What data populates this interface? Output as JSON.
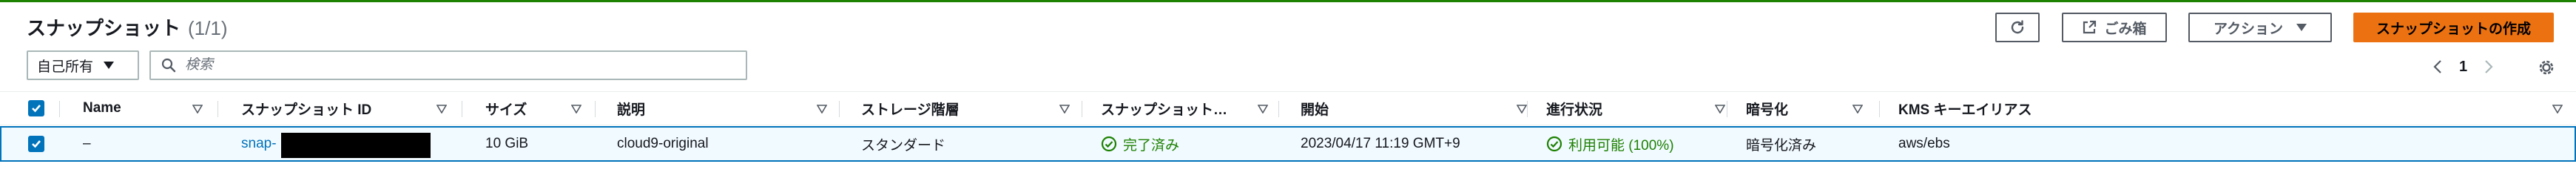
{
  "header": {
    "title": "スナップショット",
    "count": "(1/1)",
    "buttons": {
      "refresh_icon": "refresh-icon",
      "trash_label": "ごみ箱",
      "actions_label": "アクション",
      "create_label": "スナップショットの作成"
    }
  },
  "filters": {
    "owner_value": "自己所有",
    "search_placeholder": "検索"
  },
  "pagination": {
    "current_page": "1"
  },
  "table": {
    "columns": [
      "Name",
      "スナップショット ID",
      "サイズ",
      "説明",
      "ストレージ階層",
      "スナップショット…",
      "開始",
      "進行状況",
      "暗号化",
      "KMS キーエイリアス"
    ],
    "rows": [
      {
        "selected": true,
        "name": "–",
        "snapshot_id": "snap-",
        "size": "10 GiB",
        "description": "cloud9-original",
        "storage_tier": "スタンダード",
        "snapshot_status": "完了済み",
        "started": "2023/04/17 11:19 GMT+9",
        "progress": "利用可能 (100%)",
        "encryption": "暗号化済み",
        "kms_alias": "aws/ebs"
      }
    ]
  },
  "colors": {
    "accent": "#ec7211",
    "link": "#0073bb",
    "success": "#1d8102",
    "selected_row_bg": "#f1faff"
  }
}
